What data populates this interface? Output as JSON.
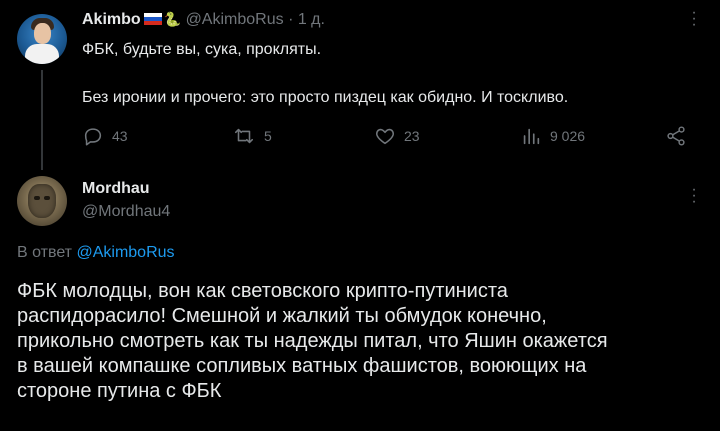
{
  "tweet1": {
    "author_name": "Akimbo",
    "author_handle": "@AkimboRus",
    "time": "· 1 д.",
    "line1": "ФБК, будьте вы, сука, прокляты.",
    "line2": "Без иронии и прочего: это просто пиздец как обидно. И тоскливо.",
    "stats": {
      "replies": "43",
      "retweets": "5",
      "likes": "23",
      "views": "9 026"
    }
  },
  "tweet2": {
    "author_name": "Mordhau",
    "author_handle": "@Mordhau4",
    "reply_prefix": "В ответ",
    "reply_to": "@AkimboRus",
    "body_lines": [
      "ФБК молодцы, вон как световского крипто-путиниста",
      "распидорасило! Смешной и жалкий ты обмудок конечно,",
      "прикольно смотреть как ты надежды питал, что Яшин окажется",
      "в вашей компашке сопливых ватных фашистов, воюющих на",
      "стороне путина с ФБК"
    ]
  },
  "icons": {
    "reply": "reply-icon",
    "retweet": "retweet-icon",
    "like": "heart-icon",
    "views": "views-icon",
    "share": "share-icon",
    "more": "more-icon",
    "flag": "russia-flag-icon",
    "snake": "snake-icon"
  },
  "colors": {
    "background": "#000000",
    "text": "#e7e9ea",
    "muted": "#71767b",
    "link": "#1d9bf0"
  }
}
